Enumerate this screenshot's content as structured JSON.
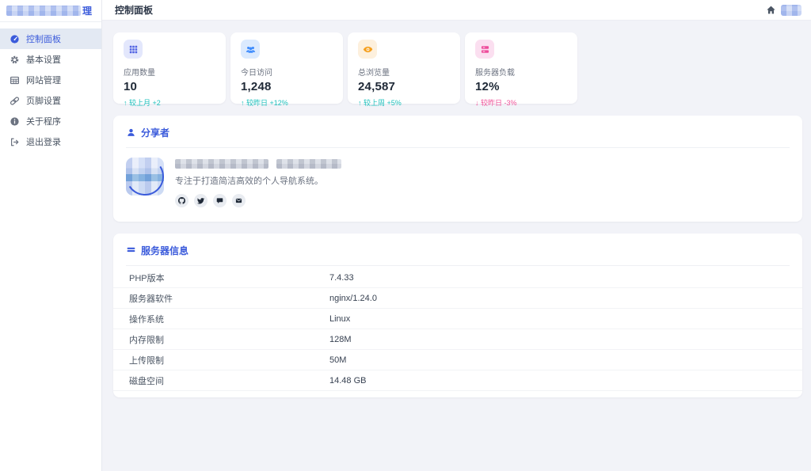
{
  "topbar": {
    "title": "控制面板"
  },
  "sidebar": {
    "title_suffix": "理",
    "items": [
      {
        "label": "控制面板",
        "icon": "gauge-icon",
        "active": true
      },
      {
        "label": "基本设置",
        "icon": "gear-icon",
        "active": false
      },
      {
        "label": "网站管理",
        "icon": "table-icon",
        "active": false
      },
      {
        "label": "页脚设置",
        "icon": "link-icon",
        "active": false
      },
      {
        "label": "关于程序",
        "icon": "info-icon",
        "active": false
      },
      {
        "label": "退出登录",
        "icon": "logout-icon",
        "active": false
      }
    ]
  },
  "stats": [
    {
      "label": "应用数量",
      "value": "10",
      "arrow": "↑",
      "change": "较上月 +2",
      "direction": "up",
      "icon": "grid-icon"
    },
    {
      "label": "今日访问",
      "value": "1,248",
      "arrow": "↑",
      "change": "较昨日 +12%",
      "direction": "up",
      "icon": "users-icon"
    },
    {
      "label": "总浏览量",
      "value": "24,587",
      "arrow": "↑",
      "change": "较上周 +5%",
      "direction": "up",
      "icon": "eye-icon"
    },
    {
      "label": "服务器负载",
      "value": "12%",
      "arrow": "↓",
      "change": "较昨日 -3%",
      "direction": "down",
      "icon": "server-icon"
    }
  ],
  "sharer": {
    "title": "分享者",
    "description": "专注于打造简洁高效的个人导航系统。",
    "social_icons": [
      "github-icon",
      "twitter-icon",
      "chat-icon",
      "email-icon"
    ]
  },
  "server_info": {
    "title": "服务器信息",
    "rows": [
      {
        "label": "PHP版本",
        "value": "7.4.33"
      },
      {
        "label": "服务器软件",
        "value": "nginx/1.24.0"
      },
      {
        "label": "操作系统",
        "value": "Linux"
      },
      {
        "label": "内存限制",
        "value": "128M"
      },
      {
        "label": "上传限制",
        "value": "50M"
      },
      {
        "label": "磁盘空间",
        "value": "14.48 GB"
      }
    ]
  },
  "colors": {
    "accent": "#3b5bdb",
    "positive": "#1fc1bd",
    "negative": "#f0559b"
  }
}
